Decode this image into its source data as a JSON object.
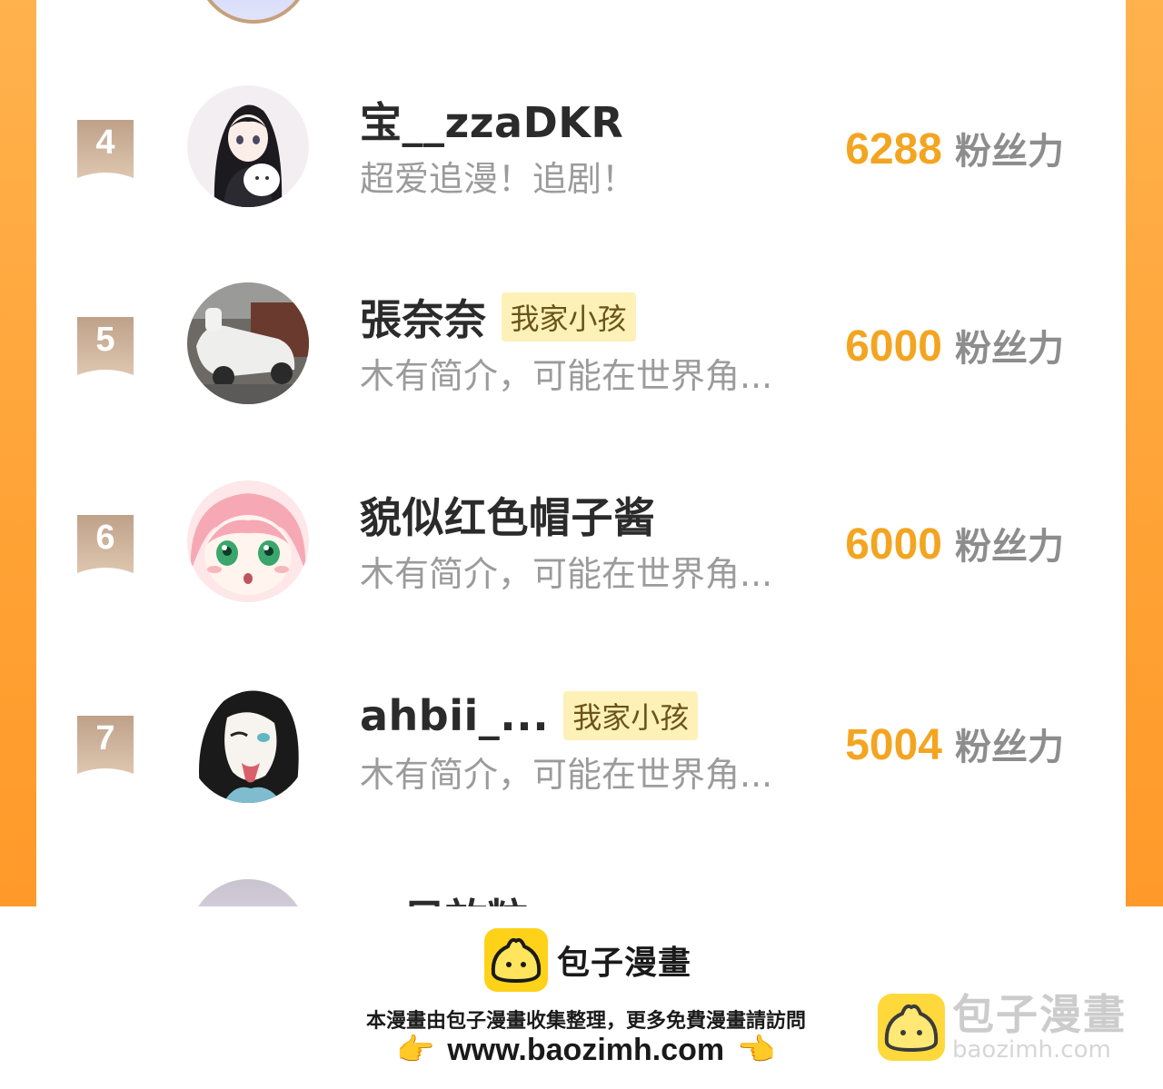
{
  "colors": {
    "frame_orange": "#ffa235",
    "score_gold": "#f3a521",
    "ribbon_tan": "#c9a88a",
    "badge_bg": "#fdf1b8"
  },
  "ranking": [
    {
      "rank": "4",
      "name": "宝__zzaDKR",
      "badge": "",
      "bio": "超爱追漫！追剧！",
      "score": "6288",
      "unit": "粉丝力",
      "avatar": "anime-girl-black-hair-avatar"
    },
    {
      "rank": "5",
      "name": "張奈奈",
      "badge": "我家小孩",
      "bio": "木有简介，可能在世界角...",
      "score": "6000",
      "unit": "粉丝力",
      "avatar": "scooter-photo-avatar"
    },
    {
      "rank": "6",
      "name": "貌似红色帽子酱",
      "badge": "",
      "bio": "木有简介，可能在世界角...",
      "score": "6000",
      "unit": "粉丝力",
      "avatar": "pink-hair-anime-avatar"
    },
    {
      "rank": "7",
      "name": "ahbii_...",
      "badge": "我家小孩",
      "bio": "木有简介，可能在世界角...",
      "score": "5004",
      "unit": "粉丝力",
      "avatar": "ink-sketch-girl-avatar"
    }
  ],
  "partial_row": {
    "name_fragment": "只放粒"
  },
  "footer": {
    "brand": "包子漫畫",
    "tagline": "本漫畫由包子漫畫收集整理，更多免費漫畫請訪問",
    "url": "www.baozimh.com",
    "hand_left": "👉",
    "hand_right": "👈",
    "watermark_title": "包子漫畫",
    "watermark_url": "baozimh.com"
  }
}
